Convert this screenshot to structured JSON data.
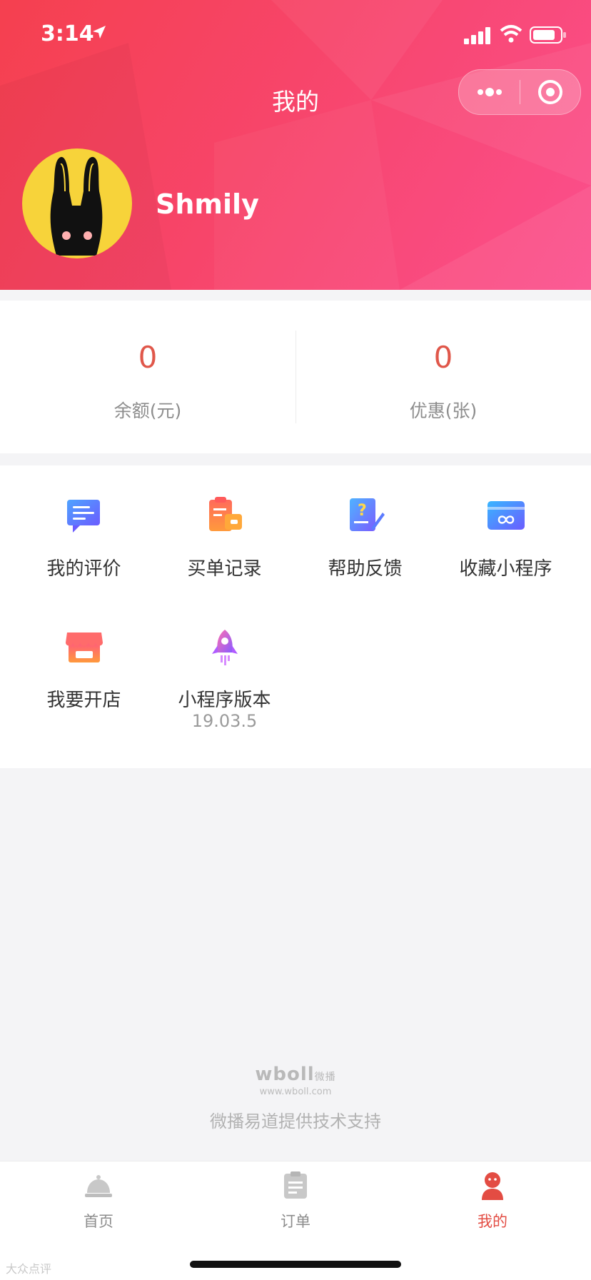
{
  "status_bar": {
    "time": "3:14"
  },
  "nav": {
    "title": "我的"
  },
  "profile": {
    "username": "Shmily"
  },
  "stats": [
    {
      "value": "0",
      "label": "余额(元)"
    },
    {
      "value": "0",
      "label": "优惠(张)"
    }
  ],
  "menu": {
    "items": [
      {
        "label": "我的评价",
        "icon": "comment-icon"
      },
      {
        "label": "买单记录",
        "icon": "bill-record-icon"
      },
      {
        "label": "帮助反馈",
        "icon": "help-feedback-icon"
      },
      {
        "label": "收藏小程序",
        "icon": "favorite-miniprogram-icon"
      },
      {
        "label": "我要开店",
        "icon": "store-icon"
      },
      {
        "label": "小程序版本",
        "icon": "rocket-icon",
        "sub": "19.03.5"
      }
    ]
  },
  "footer": {
    "logo": "wboll",
    "logo_cn": "微播",
    "url": "www.wboll.com",
    "support": "微播易道提供技术支持"
  },
  "tabbar": {
    "items": [
      {
        "label": "首页",
        "icon": "home-cloche-icon"
      },
      {
        "label": "订单",
        "icon": "order-icon"
      },
      {
        "label": "我的",
        "icon": "profile-icon",
        "active": true
      }
    ]
  },
  "watermark": "大众点评",
  "colors": {
    "header_start": "#f5404f",
    "header_end": "#fb4f8d",
    "accent": "#e34c43",
    "stat_value": "#e0574a"
  }
}
